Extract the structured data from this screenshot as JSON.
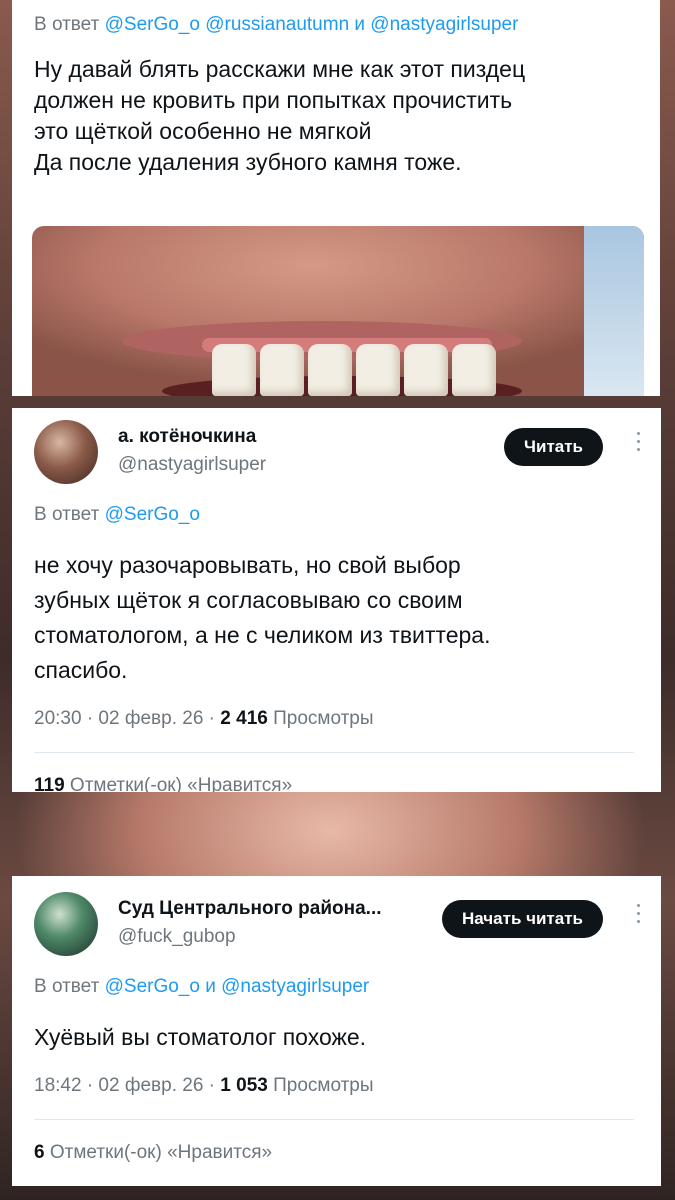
{
  "tweet1": {
    "reply_prefix": "В ответ ",
    "reply_handles": "@SerGo_o @russianautumn и @nastyagirlsuper",
    "text": "Ну давай блять расскажи мне как этот пиздец\nдолжен не кровить при попытках прочистить\nэто щёткой особенно не мягкой\nДа после удаления зубного камня тоже."
  },
  "tweet2": {
    "name": "а. котёночкина",
    "handle": "@nastyagirlsuper",
    "follow_label": "Читать",
    "reply_prefix": "В ответ ",
    "reply_handles": "@SerGo_o",
    "text": "не хочу разочаровывать, но свой выбор\nзубных щёток я согласовываю со своим\nстоматологом, а не с челиком из твиттера.\nспасибо.",
    "time": "20:30 · 02 февр. 26 · ",
    "views": "2 416",
    "views_label": " Просмотры",
    "likes_count": "119",
    "likes_label": " Отметки(-ок) «Нравится»"
  },
  "tweet3": {
    "name": "Суд Центрального района...",
    "handle": "@fuck_gubop",
    "follow_label": "Начать читать",
    "reply_prefix": "В ответ ",
    "reply_handles": "@SerGo_o и @nastyagirlsuper",
    "text": "Хуёвый вы стоматолог похоже.",
    "time": "18:42 · 02 февр. 26 · ",
    "views": "1 053",
    "views_label": " Просмотры",
    "likes_count": "6",
    "likes_label": " Отметки(-ок) «Нравится»"
  },
  "colors": {
    "link": "#1d9bf0",
    "text": "#0f1419",
    "muted": "#6e767d",
    "button": "#0f1419"
  }
}
